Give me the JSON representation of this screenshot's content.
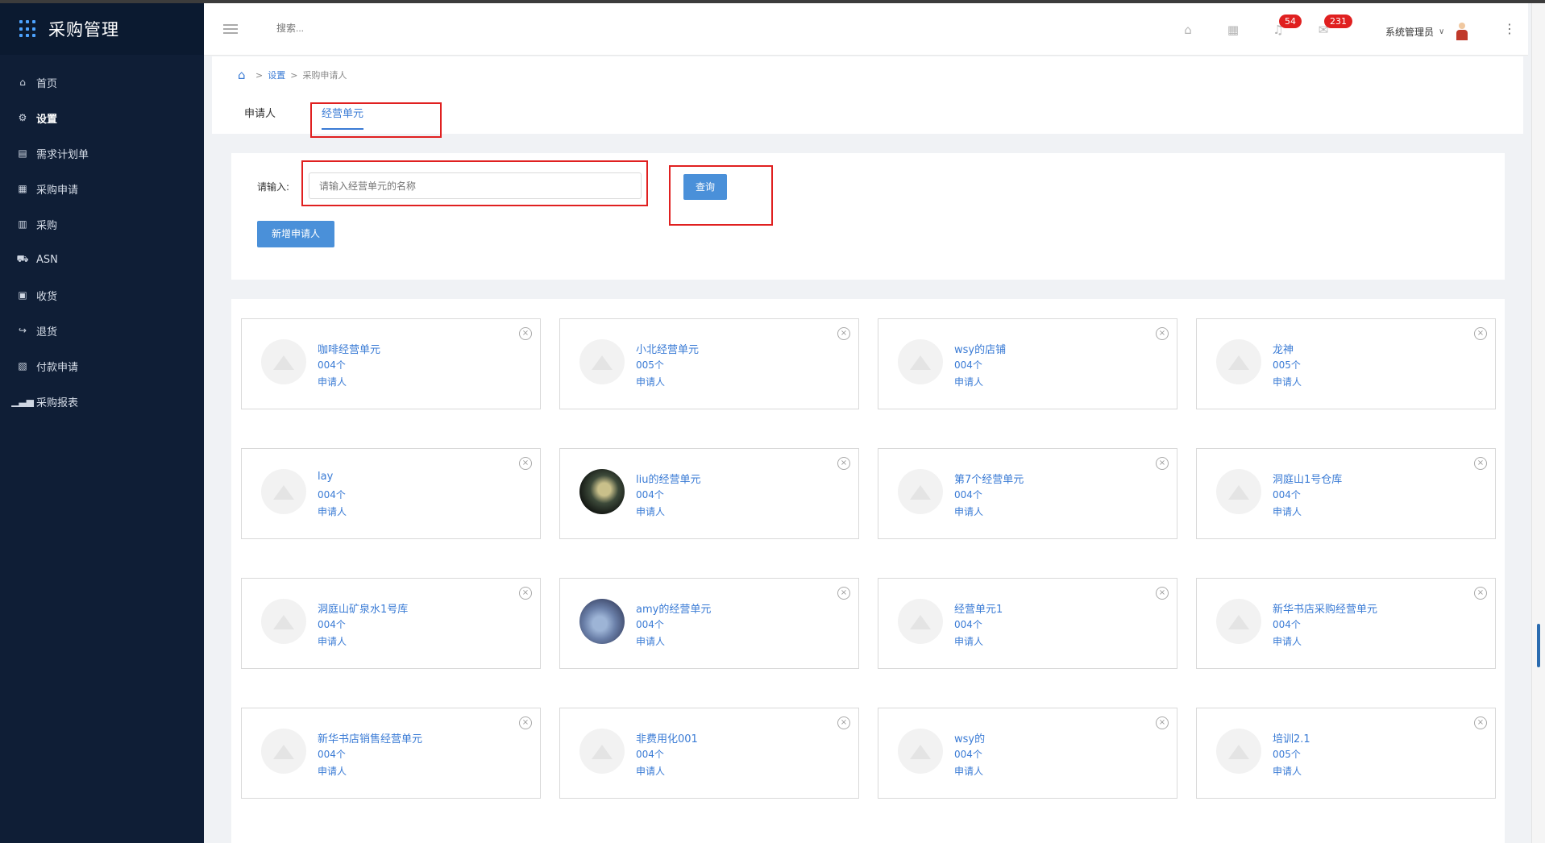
{
  "app": {
    "title": "采购管理"
  },
  "sidebar": {
    "items": [
      {
        "label": "首页",
        "icon": "home-icon"
      },
      {
        "label": "设置",
        "icon": "gear-icon"
      },
      {
        "label": "需求计划单",
        "icon": "document-icon"
      },
      {
        "label": "采购申请",
        "icon": "form-icon"
      },
      {
        "label": "采购",
        "icon": "clipboard-icon"
      },
      {
        "label": "ASN",
        "icon": "truck-icon"
      },
      {
        "label": "收货",
        "icon": "inbox-icon"
      },
      {
        "label": "退货",
        "icon": "return-icon"
      },
      {
        "label": "付款申请",
        "icon": "payment-icon"
      },
      {
        "label": "采购报表",
        "icon": "bar-chart-icon"
      }
    ],
    "active_index": 1
  },
  "header": {
    "search_placeholder": "搜索...",
    "notification_count": "54",
    "message_count": "231",
    "user_name": "系统管理员"
  },
  "breadcrumb": {
    "level1": "设置",
    "level2": "采购申请人"
  },
  "tabs": [
    {
      "label": "申请人"
    },
    {
      "label": "经营单元"
    }
  ],
  "filter": {
    "label": "请输入:",
    "placeholder": "请输入经营单元的名称",
    "query_button": "查询",
    "add_button": "新增申请人"
  },
  "cards": [
    {
      "name": "咖啡经营单元",
      "count": "004个",
      "label": "申请人"
    },
    {
      "name": "小北经营单元",
      "count": "005个",
      "label": "申请人"
    },
    {
      "name": "wsy的店铺",
      "count": "004个",
      "label": "申请人"
    },
    {
      "name": "龙神",
      "count": "005个",
      "label": "申请人"
    },
    {
      "name": "lay",
      "count": "004个",
      "label": "申请人"
    },
    {
      "name": "liu的经营单元",
      "count": "004个",
      "label": "申请人"
    },
    {
      "name": "第7个经营单元",
      "count": "004个",
      "label": "申请人"
    },
    {
      "name": "洞庭山1号仓库",
      "count": "004个",
      "label": "申请人"
    },
    {
      "name": "洞庭山矿泉水1号库",
      "count": "004个",
      "label": "申请人"
    },
    {
      "name": "amy的经营单元",
      "count": "004个",
      "label": "申请人"
    },
    {
      "name": "经营单元1",
      "count": "004个",
      "label": "申请人"
    },
    {
      "name": "新华书店采购经营单元",
      "count": "004个",
      "label": "申请人"
    },
    {
      "name": "新华书店销售经营单元",
      "count": "004个",
      "label": "申请人"
    },
    {
      "name": "非费用化001",
      "count": "004个",
      "label": "申请人"
    },
    {
      "name": "wsy的",
      "count": "004个",
      "label": "申请人"
    },
    {
      "name": "培训2.1",
      "count": "005个",
      "label": "申请人"
    }
  ]
}
